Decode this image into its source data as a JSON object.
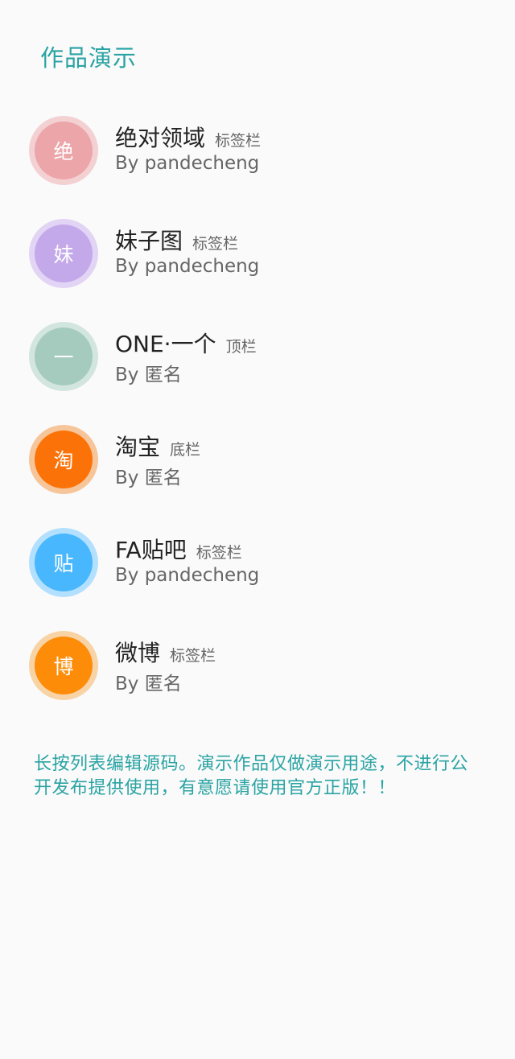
{
  "header": {
    "title": "作品演示"
  },
  "works": [
    {
      "icon_char": "绝",
      "title": "绝对领域",
      "tag": "标签栏",
      "author": "By pandecheng",
      "color": "#eca5a9",
      "ring_color": "#f3d1d3"
    },
    {
      "icon_char": "妹",
      "title": "妹子图",
      "tag": "标签栏",
      "author": "By pandecheng",
      "color": "#c4a9ea",
      "ring_color": "#e2d4f4"
    },
    {
      "icon_char": "一",
      "title": "ONE·一个",
      "tag": "顶栏",
      "author": "By 匿名",
      "color": "#a5cbbf",
      "ring_color": "#d3e5df"
    },
    {
      "icon_char": "淘",
      "title": "淘宝",
      "tag": "底栏",
      "author": "By 匿名",
      "color": "#fb7308",
      "ring_color": "#f6c59a"
    },
    {
      "icon_char": "贴",
      "title": "FA贴吧",
      "tag": "标签栏",
      "author": "By pandecheng",
      "color": "#48b7fd",
      "ring_color": "#b3e0fe"
    },
    {
      "icon_char": "博",
      "title": "微博",
      "tag": "标签栏",
      "author": "By 匿名",
      "color": "#fd8c08",
      "ring_color": "#f8d3a6"
    }
  ],
  "footer": {
    "note": "长按列表编辑源码。演示作品仅做演示用途，不进行公开发布提供使用，有意愿请使用官方正版！！"
  }
}
